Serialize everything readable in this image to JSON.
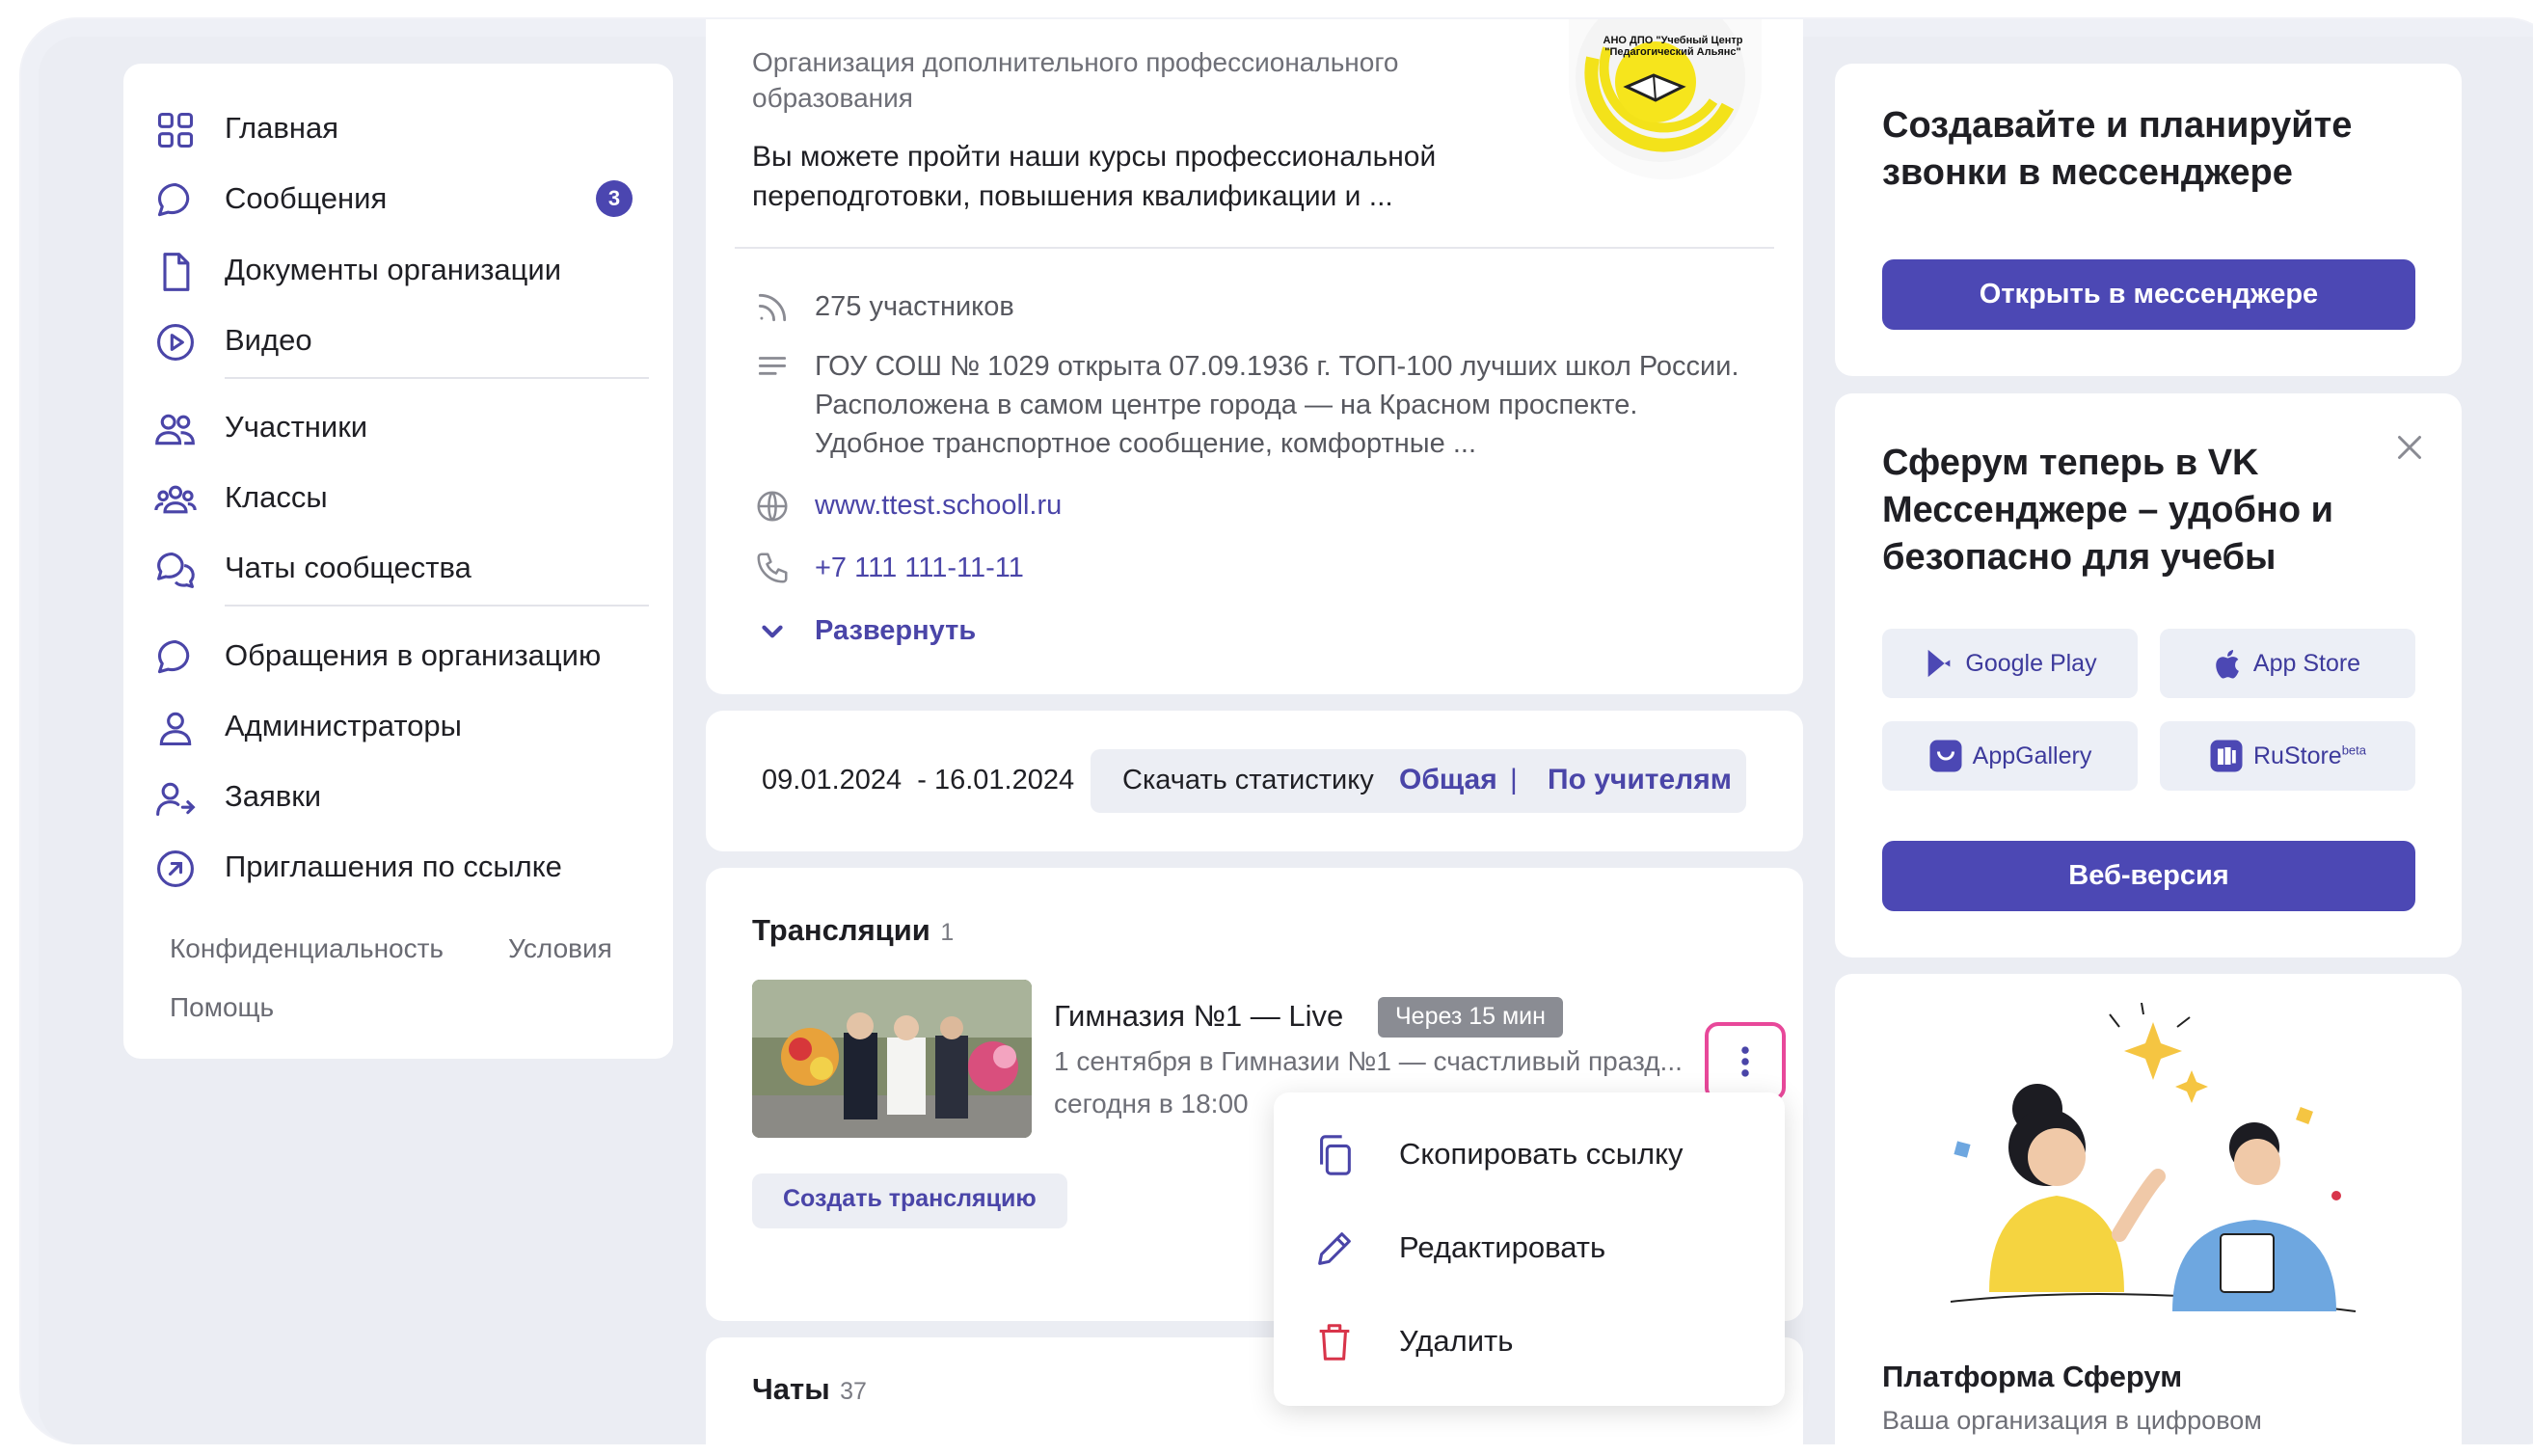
{
  "sidebar": {
    "items": [
      {
        "label": "Главная",
        "icon": "grid-icon"
      },
      {
        "label": "Сообщения",
        "icon": "message-icon",
        "badge": "3"
      },
      {
        "label": "Документы организации",
        "icon": "document-icon"
      },
      {
        "label": "Видео",
        "icon": "play-icon"
      },
      {
        "label": "Участники",
        "icon": "users-icon"
      },
      {
        "label": "Классы",
        "icon": "classes-icon"
      },
      {
        "label": "Чаты сообщества",
        "icon": "chats-icon"
      },
      {
        "label": "Обращения в организацию",
        "icon": "message-icon"
      },
      {
        "label": "Администраторы",
        "icon": "user-icon"
      },
      {
        "label": "Заявки",
        "icon": "user-arrow-icon"
      },
      {
        "label": "Приглашения по ссылке",
        "icon": "link-arrow-icon"
      }
    ],
    "footer": {
      "privacy": "Конфиденциальность",
      "terms": "Условия",
      "help": "Помощь"
    }
  },
  "org": {
    "type": "Организация дополнительного профессионального образования",
    "description": "Вы можете пройти наши курсы профессиональной переподготовки, повышения квалификации и ...",
    "logo_text": "АНО ДПО \"Учебный Центр \"Педагогический Альянс\"",
    "members": "275 участников",
    "about": "ГОУ СОШ № 1029 открыта 07.09.1936 г. ТОП-100 лучших школ России. Расположена в самом центре города — на Красном проспекте. Удобное транспортное сообщение, комфортные ...",
    "website": "www.ttest.schooll.ru",
    "phone": "+7 111 111-11-11",
    "expand": "Развернуть"
  },
  "stats": {
    "date_range": "09.01.2024  - 16.01.2024",
    "download_label": "Скачать статистику",
    "general": "Общая",
    "separator": "|",
    "by_teachers": "По учителям"
  },
  "broadcasts": {
    "title": "Трансляции",
    "count": "1",
    "item": {
      "title": "Гимназия №1 — Live",
      "badge": "Через 15 мин",
      "description": "1 сентября в Гимназии №1 — счастливый празд...",
      "time": "сегодня в 18:00"
    },
    "create_button": "Создать трансляцию"
  },
  "context_menu": {
    "items": [
      {
        "label": "Скопировать ссылку",
        "icon": "copy-icon"
      },
      {
        "label": "Редактировать",
        "icon": "pencil-icon"
      },
      {
        "label": "Удалить",
        "icon": "trash-icon"
      }
    ]
  },
  "chats": {
    "title": "Чаты",
    "count": "37"
  },
  "right": {
    "calls_title": "Создавайте и планируйте звонки в мессенджере",
    "calls_button": "Открыть в мессенджере",
    "promo_title": "Сферум теперь в VK Мессенджере – удобно и безопасно для учебы",
    "stores": {
      "google": "Google Play",
      "apple": "App Store",
      "huawei": "AppGallery",
      "rustore": "RuStore",
      "rustore_sup": "beta"
    },
    "web_button": "Веб-версия",
    "platform_title": "Платформа Сферум",
    "platform_subtitle": "Ваша организация в цифровом"
  },
  "colors": {
    "accent": "#4c48b4",
    "link": "#4a45a8",
    "danger": "#d8344a",
    "highlight": "#e8489a"
  }
}
